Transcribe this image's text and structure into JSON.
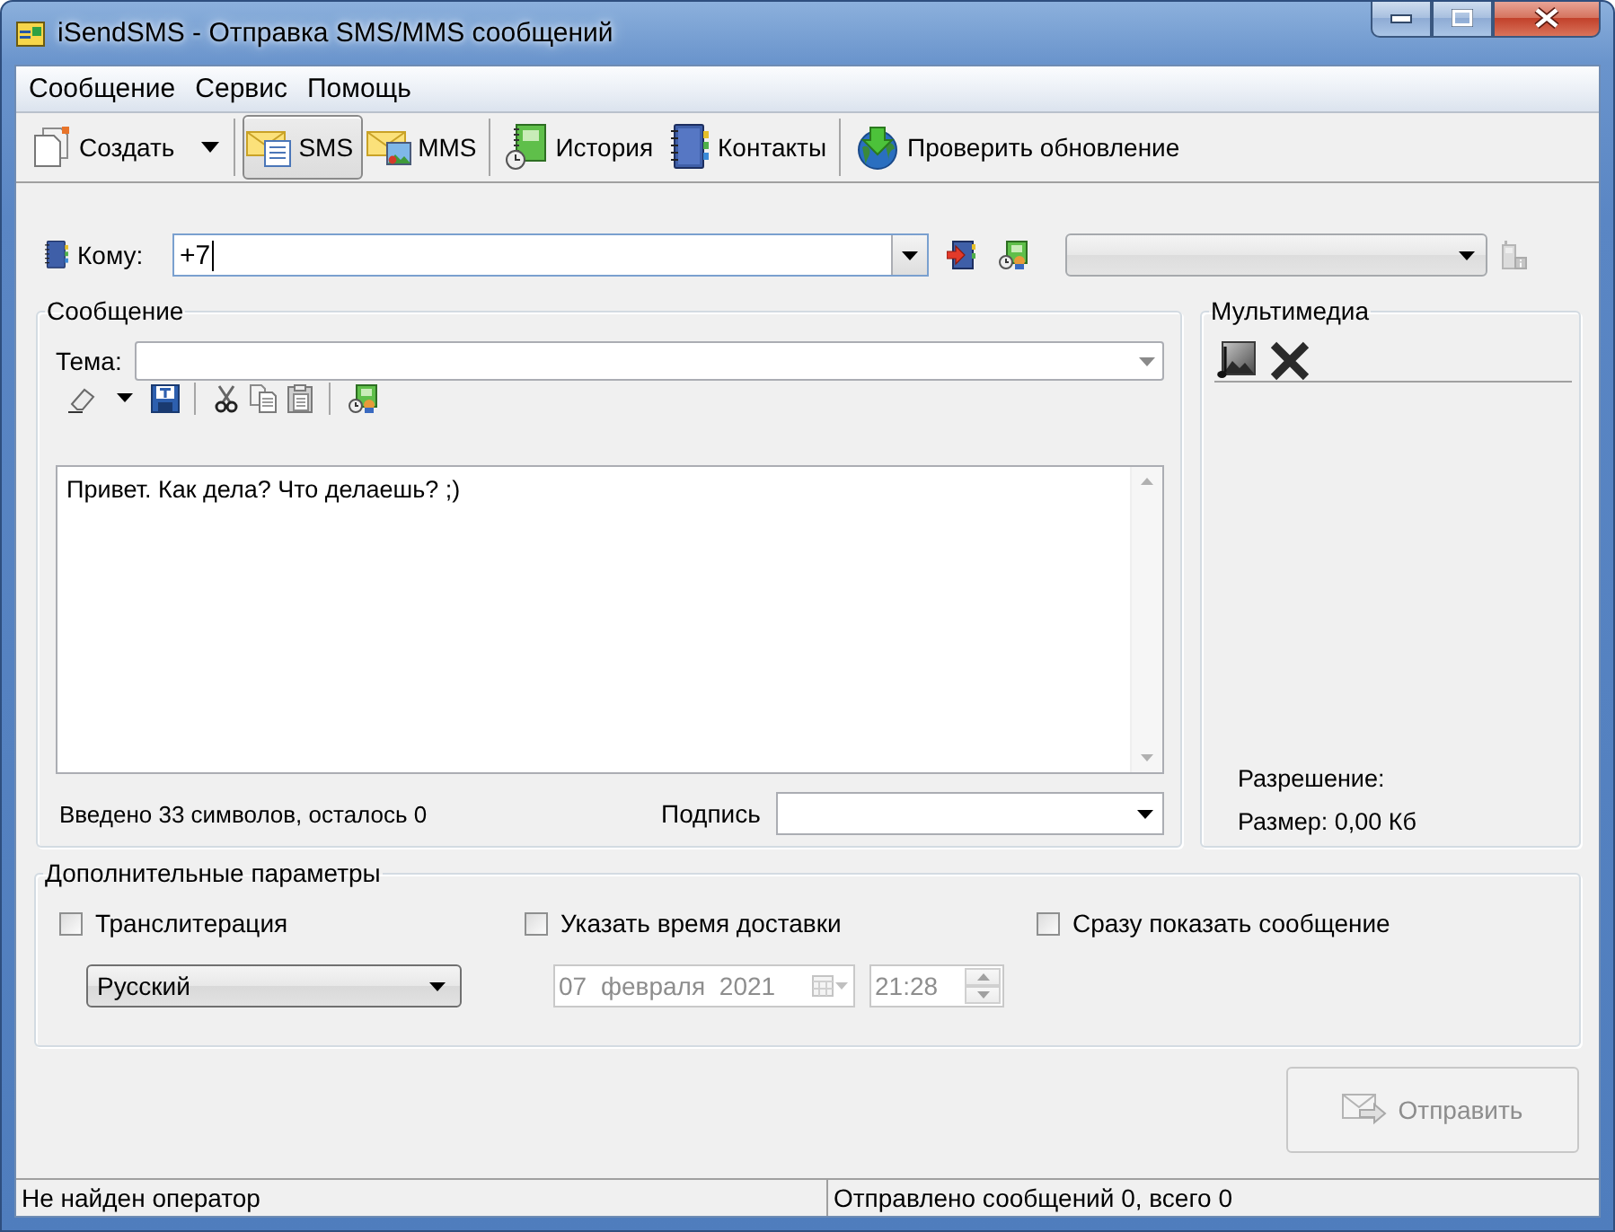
{
  "window": {
    "title": "iSendSMS - Отправка SMS/MMS сообщений"
  },
  "menu": [
    "Сообщение",
    "Сервис",
    "Помощь"
  ],
  "toolbar": {
    "create": {
      "label": "Создать"
    },
    "modes": [
      {
        "label": "SMS",
        "selected": true
      },
      {
        "label": "MMS",
        "selected": false
      }
    ],
    "tools": [
      {
        "label": "История"
      },
      {
        "label": "Контакты"
      }
    ],
    "update": {
      "label": "Проверить обновление"
    }
  },
  "recipient": {
    "label": "Кому:",
    "value": "+7"
  },
  "operator_select": {
    "disabled": true
  },
  "message": {
    "title": "Сообщение",
    "subject_label": "Тема:",
    "text": "Привет. Как дела? Что делаешь? ;)",
    "counter": "Введено 33 символов, осталось 0",
    "signature_label": "Подпись"
  },
  "multimedia": {
    "title": "Мультимедиа",
    "resolution": "Разрешение:",
    "size": "Размер: 0,00 Кб"
  },
  "options": {
    "title": "Дополнительные параметры",
    "checkboxes": [
      {
        "label": "Транслитерация",
        "checked": false
      },
      {
        "label": "Указать время доставки",
        "checked": false
      },
      {
        "label": "Сразу показать сообщение",
        "checked": false
      }
    ],
    "language": "Русский",
    "date": {
      "value": "07 февраля 2021",
      "disabled": true
    },
    "time": {
      "value": "21:28",
      "disabled": true
    }
  },
  "send_button": {
    "label": "Отправить",
    "disabled": true
  },
  "status_bar": [
    "Не найден оператор",
    "Отправлено сообщений 0, всего 0"
  ]
}
